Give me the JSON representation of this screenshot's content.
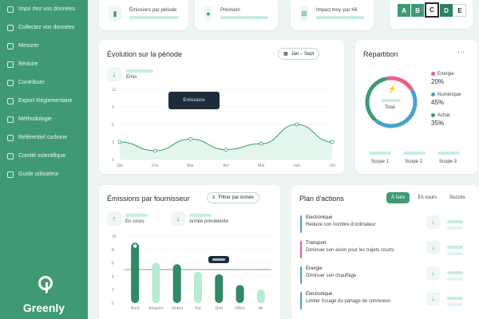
{
  "colors": {
    "brand": "#3f9a73",
    "accent_light": "#c9eedc",
    "energy": "#e8628b",
    "digital": "#4aa3c8",
    "purchase": "#3f9a73"
  },
  "sidebar": {
    "items": [
      {
        "label": "Impo rtez vos données",
        "icon": "upload-icon"
      },
      {
        "label": "Collectez vos données",
        "icon": "collect-icon"
      },
      {
        "label": "Mesurer",
        "icon": "measure-icon"
      },
      {
        "label": "Réduire",
        "icon": "reduce-icon"
      },
      {
        "label": "Contribuer",
        "icon": "contribute-icon"
      },
      {
        "label": "Export Réglementaire",
        "icon": "export-icon"
      },
      {
        "label": "Méthodologie",
        "icon": "method-icon"
      },
      {
        "label": "Référentiel carbone",
        "icon": "reference-icon"
      },
      {
        "label": "Comité scientifique",
        "icon": "committee-icon"
      },
      {
        "label": "Guide utilisateur",
        "icon": "guide-icon"
      }
    ],
    "brand": "Greenly"
  },
  "stats": {
    "emissions_label": "Émissions par période",
    "forecast_label": "Prévision",
    "impact_label": "Impact moy. par K€",
    "scores": [
      "A",
      "B",
      "C",
      "D",
      "E"
    ],
    "selected_score": "C"
  },
  "evolution": {
    "title": "Évolution sur la période",
    "period": "Jan – Sept",
    "unit": "Émis",
    "tooltip": "Emissions",
    "chart_data": {
      "type": "area",
      "x": [
        "Jan",
        "Fév",
        "Mar",
        "Avr",
        "Mai",
        "Juin",
        "Juil"
      ],
      "values": [
        3,
        1.5,
        3.5,
        1.7,
        2.7,
        6,
        3
      ],
      "ylim": [
        0,
        12
      ],
      "yticks": [
        12,
        9,
        6,
        3,
        0
      ]
    }
  },
  "repartition": {
    "title": "Répartition",
    "total_label": "Total",
    "legend": [
      {
        "name": "Energie",
        "pct": "20%",
        "color": "#e8628b"
      },
      {
        "name": "Numérique",
        "pct": "45%",
        "color": "#4aa3c8"
      },
      {
        "name": "Achat",
        "pct": "35%",
        "color": "#3f9a73"
      }
    ],
    "scopes": [
      "Scope 1",
      "Scope 2",
      "Scope 3"
    ],
    "chart_data": {
      "type": "pie",
      "labels": [
        "Energie",
        "Numérique",
        "Achat"
      ],
      "values": [
        20,
        45,
        35
      ]
    }
  },
  "suppliers": {
    "title": "Émissions par fournisseur",
    "filter": "Filtrer par Année",
    "stat1": "En cours",
    "stat2": "Année précédente",
    "chart_data": {
      "type": "bar",
      "categories": [
        "Nord",
        "Amazon",
        "Vinted",
        "Kia",
        "Grid",
        "Office",
        "Air"
      ],
      "values": [
        9,
        6,
        5.8,
        4.7,
        4.3,
        2.7,
        2
      ],
      "ylim": [
        0,
        10
      ],
      "yticks": [
        10,
        8,
        6,
        4,
        2,
        0
      ],
      "highlight_index": [
        0,
        3,
        5
      ]
    }
  },
  "plan": {
    "title": "Plan d'actions",
    "tabs": [
      "À faire",
      "En cours",
      "Succès"
    ],
    "items": [
      {
        "category": "Electronique",
        "desc": "Réduire son nombre d'ordinateur",
        "color": "#4aa3c8"
      },
      {
        "category": "Transport",
        "desc": "Diminuer son avion pour les trajets courts",
        "color": "#e8628b"
      },
      {
        "category": "Energie",
        "desc": "Diminuer son chauffage",
        "color": "#4aa3c8"
      },
      {
        "category": "Electronique",
        "desc": "Limiter l'usage du partage de connexion",
        "color": "#4aa3c8"
      }
    ]
  }
}
